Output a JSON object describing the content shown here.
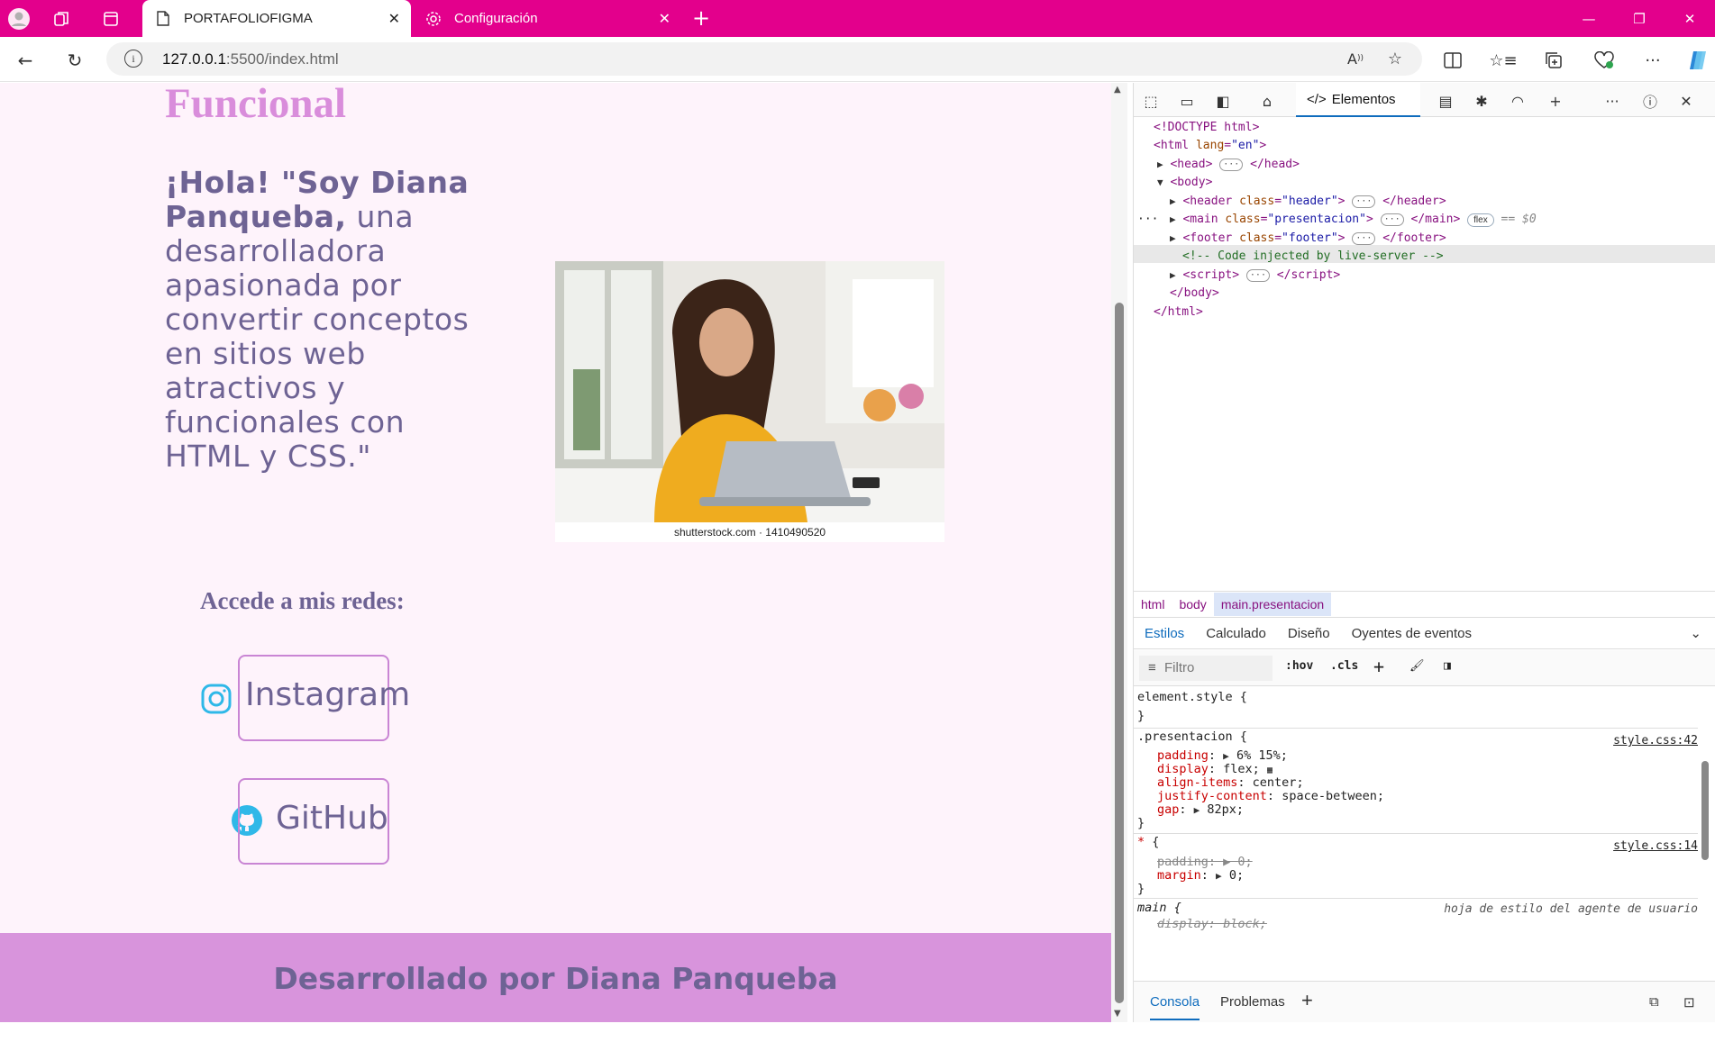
{
  "browser": {
    "tabs": [
      {
        "label": "PORTAFOLIOFIGMA",
        "active": true
      },
      {
        "label": "Configuración",
        "active": false
      }
    ],
    "url_host": "127.0.0.1",
    "url_path": ":5500/index.html",
    "accent": "#e3008c"
  },
  "page": {
    "heading": "Funcional",
    "intro_bold": "¡Hola! \"Soy Diana Panqueba,",
    "intro_rest": " una desarrolladora apasionada por convertir conceptos en sitios web atractivos y funcionales con HTML y CSS.\"",
    "photo_caption": "shutterstock.com · 1410490520",
    "redes_title": "Accede a mis redes:",
    "social": [
      {
        "label": "Instagram",
        "icon": "instagram-icon"
      },
      {
        "label": "GitHub",
        "icon": "github-icon"
      }
    ],
    "footer": "Desarrollado por Diana Panqueba",
    "colors": {
      "background": "#fef3fb",
      "heading": "#d98ddb",
      "text": "#6e6394",
      "footer": "#d894dc"
    }
  },
  "devtools": {
    "active_tab": "Elementos",
    "dom": {
      "doctype": "<!DOCTYPE html>",
      "comment": "<!-- Code injected by live-server -->",
      "flex_badge": "flex",
      "selected_marker": "== $0"
    },
    "breadcrumbs": [
      "html",
      "body",
      "main.presentacion"
    ],
    "style_tabs": [
      "Estilos",
      "Calculado",
      "Diseño",
      "Oyentes de eventos"
    ],
    "filter_placeholder": "Filtro",
    "filter_buttons": [
      ":hov",
      ".cls"
    ],
    "rules": {
      "element_style": "element.style {",
      "presentacion_selector": ".presentacion {",
      "presentacion_link": "style.css:42",
      "presentacion_decls": [
        {
          "prop": "padding",
          "value": "6% 15%;"
        },
        {
          "prop": "display",
          "value": "flex;"
        },
        {
          "prop": "align-items",
          "value": "center;"
        },
        {
          "prop": "justify-content",
          "value": "space-between;"
        },
        {
          "prop": "gap",
          "value": "82px;"
        }
      ],
      "universal_selector": "* {",
      "universal_link": "style.css:14",
      "universal_decls": [
        {
          "prop": "padding",
          "value": "0;"
        },
        {
          "prop": "margin",
          "value": "0;"
        }
      ],
      "main_selector": "main {",
      "main_source": "hoja de estilo del agente de usuario",
      "main_decl": "display: block;"
    },
    "drawer_tabs": [
      "Consola",
      "Problemas"
    ]
  }
}
